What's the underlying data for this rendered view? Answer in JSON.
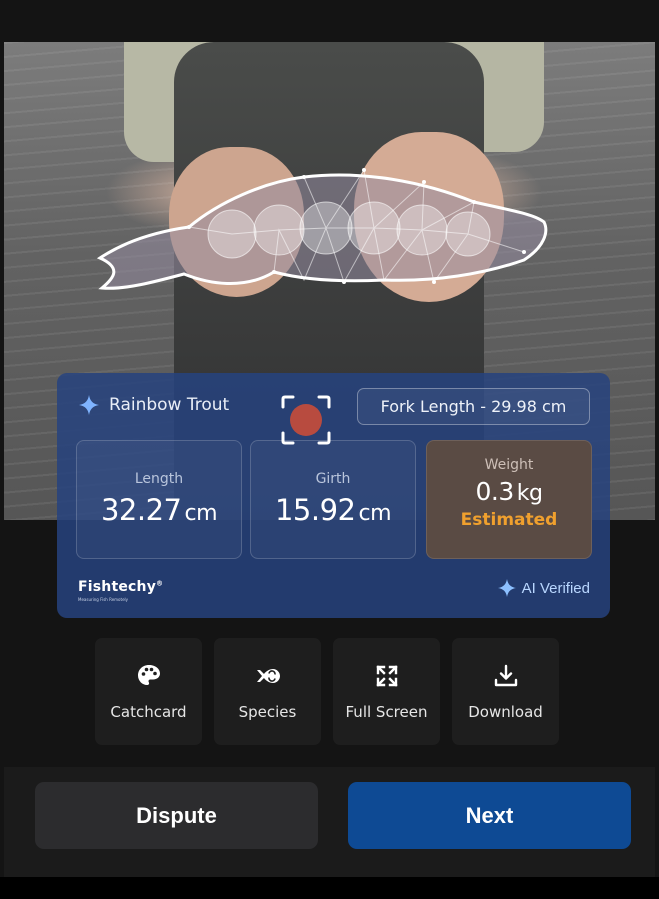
{
  "result": {
    "species": "Rainbow Trout",
    "fork_length": "Fork Length - 29.98 cm",
    "metrics": [
      {
        "label": "Length",
        "value": "32.27",
        "unit": "cm"
      },
      {
        "label": "Girth",
        "value": "15.92",
        "unit": "cm"
      },
      {
        "label": "Weight",
        "value": "0.3",
        "unit": "kg",
        "status": "Estimated"
      }
    ],
    "brand": "Fishtechy",
    "brand_mark": "®",
    "brand_tagline": "Measuring Fish Remotely",
    "verified_label": "AI Verified"
  },
  "actions": [
    {
      "label": "Catchcard",
      "icon": "palette-icon"
    },
    {
      "label": "Species",
      "icon": "fish-swap-icon"
    },
    {
      "label": "Full Screen",
      "icon": "expand-icon"
    },
    {
      "label": "Download",
      "icon": "download-icon"
    }
  ],
  "buttons": {
    "dispute": "Dispute",
    "next": "Next"
  },
  "colors": {
    "card": "#26427e",
    "accent_blue": "#0e4a94",
    "estimated": "#f0a02e",
    "sparkle": "#7fb4ff"
  }
}
